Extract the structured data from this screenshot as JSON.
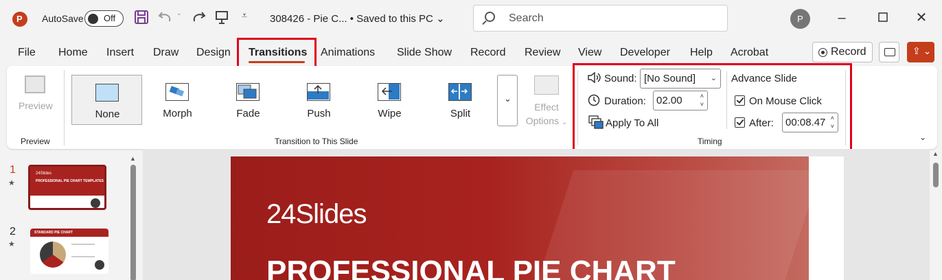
{
  "titlebar": {
    "autosave_label": "AutoSave",
    "autosave_state": "Off",
    "doc_title": "308426 -  Pie C... • Saved to this PC",
    "chevron": "⌄",
    "search_placeholder": "Search",
    "avatar_initial": "P",
    "icons": [
      "powerpoint-logo",
      "save-icon",
      "undo-icon",
      "redo-icon",
      "present-icon",
      "customize-icon"
    ]
  },
  "menu": {
    "tabs": [
      "File",
      "Home",
      "Insert",
      "Draw",
      "Design",
      "Transitions",
      "Animations",
      "Slide Show",
      "Record",
      "Review",
      "View",
      "Developer",
      "Help",
      "Acrobat"
    ],
    "active": "Transitions",
    "record_label": "Record"
  },
  "ribbon": {
    "preview": {
      "button_label": "Preview",
      "group_label": "Preview"
    },
    "transitions": {
      "items": [
        "None",
        "Morph",
        "Fade",
        "Push",
        "Wipe",
        "Split"
      ],
      "selected": "None",
      "effect_options_line1": "Effect",
      "effect_options_line2": "Options",
      "group_label": "Transition to This Slide"
    },
    "timing": {
      "sound_label": "Sound:",
      "sound_value": "[No Sound]",
      "duration_label": "Duration:",
      "duration_value": "02.00",
      "apply_all_label": "Apply To All",
      "advance_title": "Advance Slide",
      "on_mouse_click_label": "On Mouse Click",
      "on_mouse_click_checked": true,
      "after_label": "After:",
      "after_checked": true,
      "after_value": "00:08.47",
      "group_label": "Timing"
    }
  },
  "thumbnails": [
    {
      "number": "1",
      "star": "★",
      "title": "PROFESSIONAL PIE CHART TEMPLATES",
      "brand": "24Slides"
    },
    {
      "number": "2",
      "star": "★",
      "title": "STANDARD PIE CHART"
    }
  ],
  "slide": {
    "brand": "24Slides",
    "headline": "PROFESSIONAL PIE CHART"
  },
  "colors": {
    "accent": "#c43e1c",
    "highlight": "#e0001b",
    "slide_red": "#a8231f"
  }
}
